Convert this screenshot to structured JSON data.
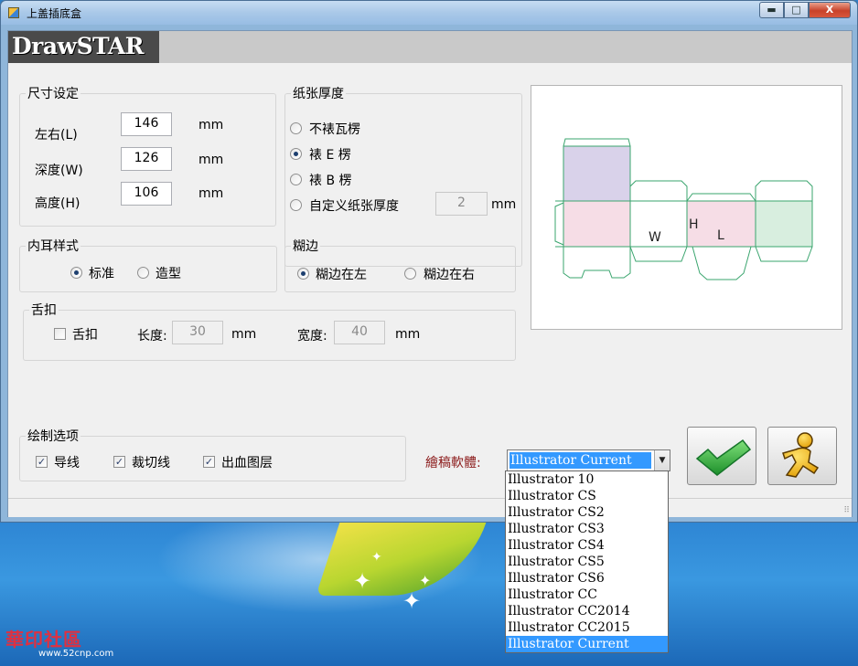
{
  "window": {
    "title": "上盖插底盒",
    "minimize_glyph": "▬",
    "maximize_glyph": "□",
    "close_glyph": "X"
  },
  "logo": "DrawSTAR",
  "size_group": {
    "legend": "尺寸设定",
    "rows": [
      {
        "label": "左右(L)",
        "value": "146",
        "unit": "mm"
      },
      {
        "label": "深度(W)",
        "value": "126",
        "unit": "mm"
      },
      {
        "label": "高度(H)",
        "value": "106",
        "unit": "mm"
      }
    ]
  },
  "paper_group": {
    "legend": "纸张厚度",
    "options": [
      {
        "label": "不裱瓦楞",
        "checked": false
      },
      {
        "label": "裱 E 楞",
        "checked": true
      },
      {
        "label": "裱 B 楞",
        "checked": false
      },
      {
        "label": "自定义纸张厚度",
        "checked": false
      }
    ],
    "custom_value": "2",
    "custom_unit": "mm"
  },
  "ear_group": {
    "legend": "内耳样式",
    "options": [
      {
        "label": "标准",
        "checked": true
      },
      {
        "label": "造型",
        "checked": false
      }
    ]
  },
  "glue_group": {
    "legend": "糊边",
    "options": [
      {
        "label": "糊边在左",
        "checked": true
      },
      {
        "label": "糊边在右",
        "checked": false
      }
    ]
  },
  "tongue_group": {
    "legend": "舌扣",
    "checkbox_label": "舌扣",
    "checked": false,
    "length_label": "长度:",
    "length_value": "30",
    "length_unit": "mm",
    "width_label": "宽度:",
    "width_value": "40",
    "width_unit": "mm"
  },
  "preview": {
    "labels": {
      "w": "W",
      "h": "H",
      "l": "L"
    },
    "colors": {
      "outline": "#3aa56e",
      "top_panel": "#d9d2ea",
      "side": "#f6dde6",
      "end": "#d8eedf"
    }
  },
  "draw_group": {
    "legend": "绘制选项",
    "options": [
      {
        "label": "导线",
        "checked": true
      },
      {
        "label": "裁切线",
        "checked": true
      },
      {
        "label": "出血图层",
        "checked": true
      }
    ]
  },
  "software": {
    "label": "繪稿軟體:",
    "label_color": "#8b1a1a",
    "selected": "Illustrator Current",
    "options": [
      "Illustrator 10",
      "Illustrator CS",
      "Illustrator CS2",
      "Illustrator CS3",
      "Illustrator CS4",
      "Illustrator CS5",
      "Illustrator CS6",
      "Illustrator CC",
      "Illustrator CC2014",
      "Illustrator CC2015",
      "Illustrator Current"
    ]
  },
  "buttons": {
    "ok_icon": "check-icon",
    "run_icon": "running-man-icon"
  },
  "watermark": {
    "brand": "華印社區",
    "url": "www.52cnp.com"
  }
}
